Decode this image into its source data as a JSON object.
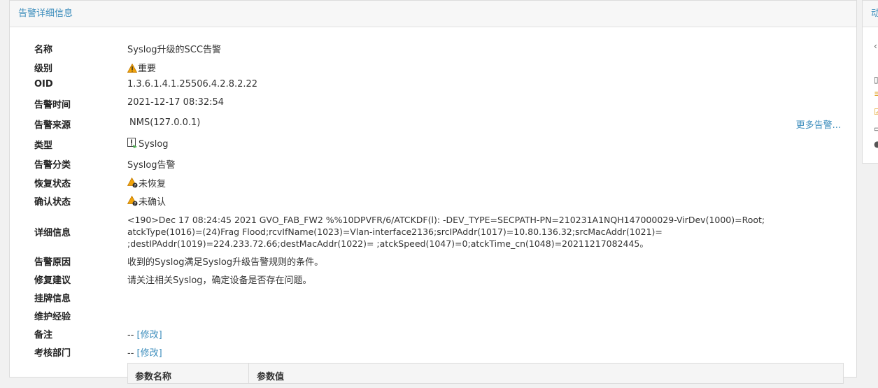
{
  "panel": {
    "title": "告警详细信息"
  },
  "side": {
    "title": "动"
  },
  "details": {
    "name": {
      "label": "名称",
      "value": "Syslog升级的SCC告警"
    },
    "level": {
      "label": "级别",
      "value": "重要"
    },
    "oid": {
      "label": "OID",
      "value": "1.3.6.1.4.1.25506.4.2.8.2.22"
    },
    "time": {
      "label": "告警时间",
      "value": "2021-12-17 08:32:54"
    },
    "source": {
      "label": "告警来源",
      "value": "NMS(127.0.0.1)",
      "more": "更多告警..."
    },
    "type": {
      "label": "类型",
      "value": "Syslog"
    },
    "category": {
      "label": "告警分类",
      "value": "Syslog告警"
    },
    "recovery": {
      "label": "恢复状态",
      "value": "未恢复"
    },
    "ack": {
      "label": "确认状态",
      "value": "未确认"
    },
    "detail": {
      "label": "详细信息",
      "value": "<190>Dec 17 08:24:45 2021 GVO_FAB_FW2 %%10DPVFR/6/ATCKDF(l): -DEV_TYPE=SECPATH-PN=210231A1NQH147000029-VirDev(1000)=Root; atckType(1016)=(24)Frag Flood;rcvIfName(1023)=Vlan-interface2136;srcIPAddr(1017)=10.80.136.32;srcMacAddr(1021)= ;destIPAddr(1019)=224.233.72.66;destMacAddr(1022)= ;atckSpeed(1047)=0;atckTime_cn(1048)=20211217082445。"
    },
    "reason": {
      "label": "告警原因",
      "value": "收到的Syslog满足Syslog升级告警规则的条件。"
    },
    "fix": {
      "label": "修复建议",
      "value": "请关注相关Syslog，确定设备是否存在问题。"
    },
    "tag": {
      "label": "挂牌信息",
      "value": ""
    },
    "experience": {
      "label": "维护经验",
      "value": ""
    },
    "remark": {
      "label": "备注",
      "value": "--",
      "edit": "[修改]"
    },
    "dept": {
      "label": "考核部门",
      "value": "--",
      "edit": "[修改]"
    }
  },
  "param_table": {
    "col1": "参数名称",
    "col2": "参数值"
  },
  "colors": {
    "accent": "#3c8dbc",
    "warning": "#f0a30a"
  },
  "icons": {
    "level": "warning-icon",
    "type": "syslog-icon",
    "recovery": "warning-question-icon",
    "ack": "warning-question-icon"
  }
}
